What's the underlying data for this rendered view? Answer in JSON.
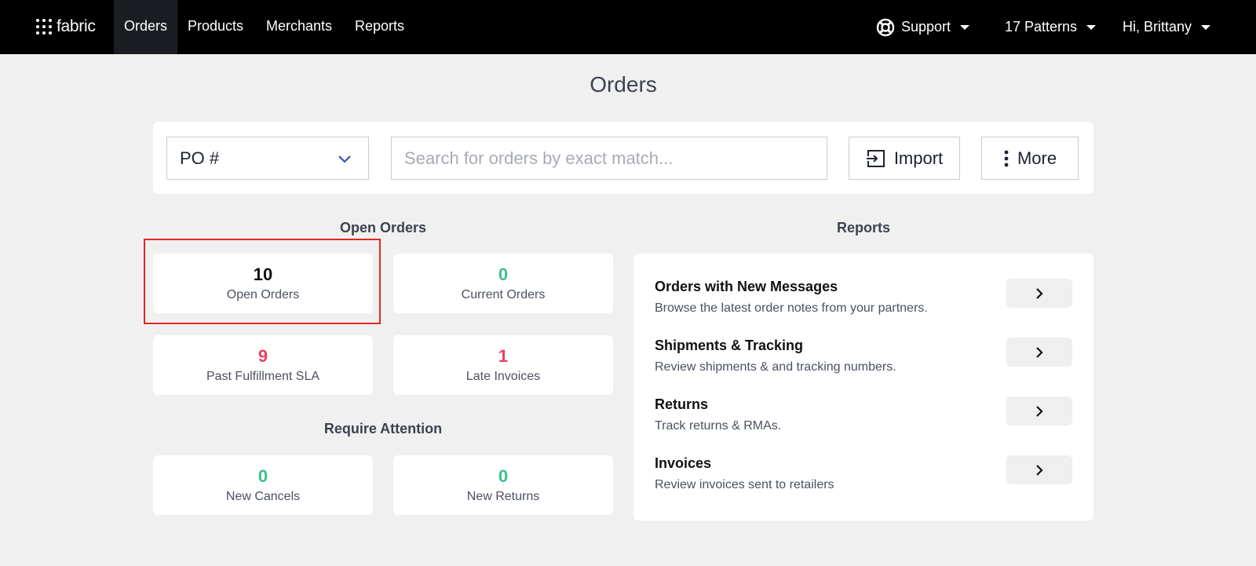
{
  "nav": {
    "logo_text": "fabric",
    "items": [
      {
        "label": "Orders",
        "active": true
      },
      {
        "label": "Products",
        "active": false
      },
      {
        "label": "Merchants",
        "active": false
      },
      {
        "label": "Reports",
        "active": false
      }
    ],
    "support_label": "Support",
    "account_label": "17 Patterns",
    "user_label": "Hi, Brittany"
  },
  "page": {
    "title": "Orders"
  },
  "search": {
    "field_select_value": "PO #",
    "placeholder": "Search for orders by exact match...",
    "value": "",
    "import_label": "Import",
    "more_label": "More"
  },
  "open_orders": {
    "heading": "Open Orders",
    "cards": [
      {
        "value": "10",
        "label": "Open Orders",
        "color": "#111111"
      },
      {
        "value": "0",
        "label": "Current Orders",
        "color": "#3bbf8a"
      },
      {
        "value": "9",
        "label": "Past Fulfillment SLA",
        "color": "#e8415f"
      },
      {
        "value": "1",
        "label": "Late Invoices",
        "color": "#e8415f"
      }
    ]
  },
  "require_attention": {
    "heading": "Require Attention",
    "cards": [
      {
        "value": "0",
        "label": "New Cancels",
        "color": "#3bbf8a"
      },
      {
        "value": "0",
        "label": "New Returns",
        "color": "#3bbf8a"
      }
    ]
  },
  "reports": {
    "heading": "Reports",
    "items": [
      {
        "title": "Orders with New Messages",
        "description": "Browse the latest order notes from your partners."
      },
      {
        "title": "Shipments & Tracking",
        "description": "Review shipments & and tracking numbers."
      },
      {
        "title": "Returns",
        "description": "Track returns & RMAs."
      },
      {
        "title": "Invoices",
        "description": "Review invoices sent to retailers"
      }
    ]
  },
  "colors": {
    "topbar": "#000000",
    "page_bg": "#f0f0f0",
    "positive": "#3bbf8a",
    "negative": "#e8415f",
    "highlight": "#e0281e",
    "chevron_accent": "#3a4fb8"
  },
  "icons": {
    "logo": "grid-dots-icon",
    "support": "lifebuoy-icon",
    "dropdown": "caret-down-icon",
    "select": "chevron-down-icon",
    "import": "import-icon",
    "more": "vertical-dots-icon",
    "report_open": "chevron-right-icon"
  }
}
